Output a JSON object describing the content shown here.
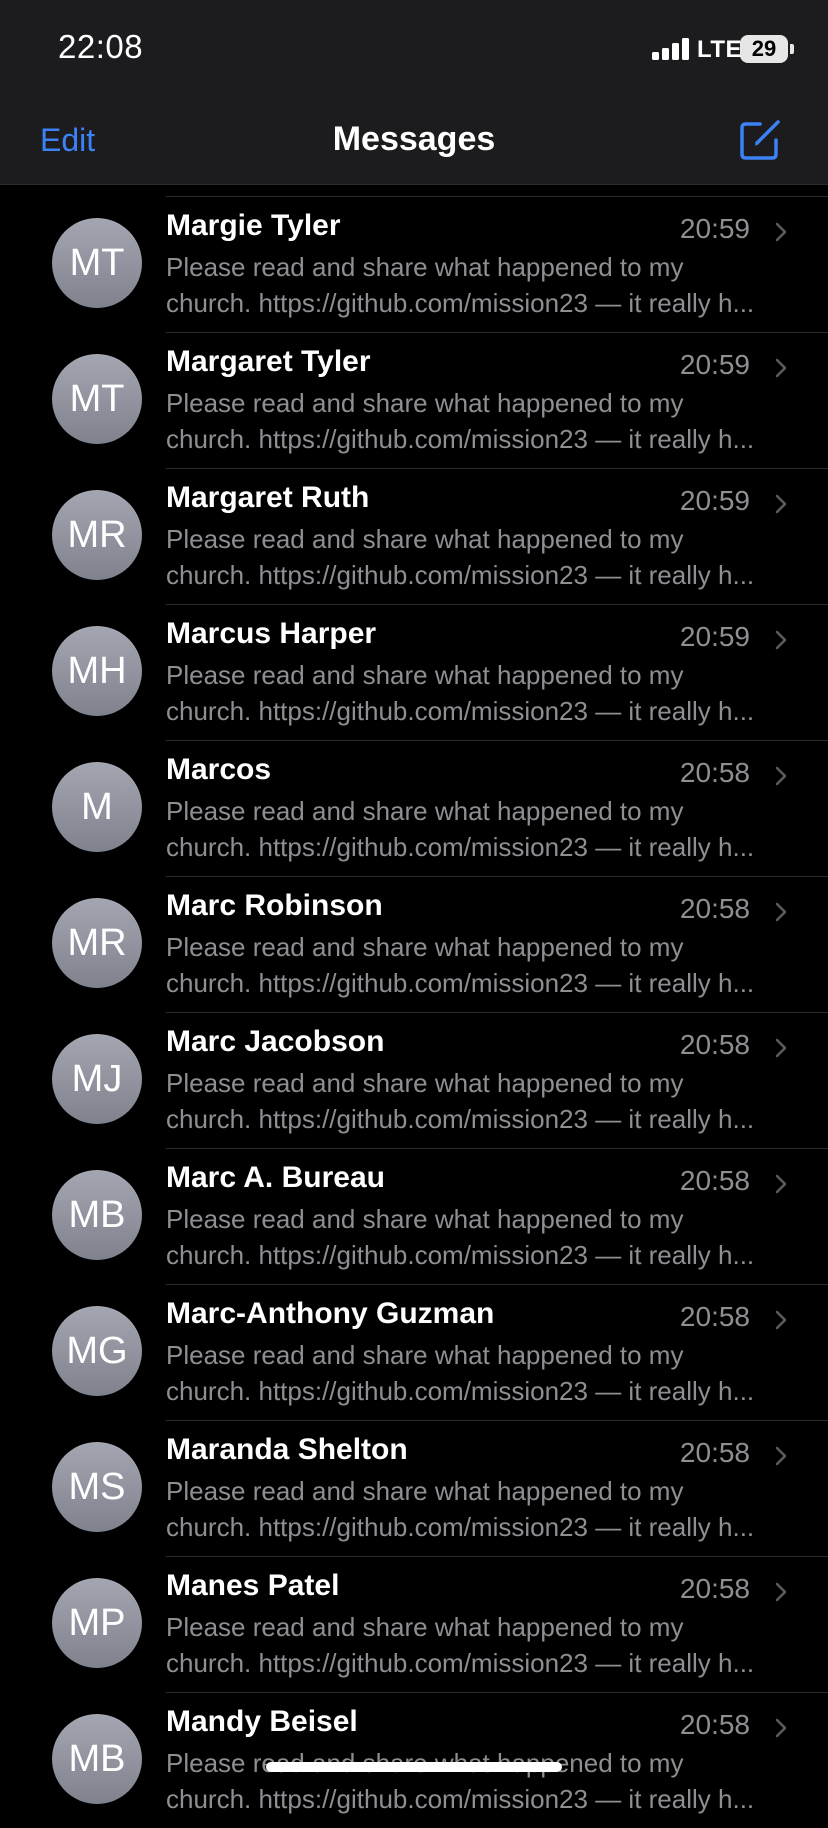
{
  "status": {
    "time": "22:08",
    "network": "LTE",
    "battery": "29"
  },
  "nav": {
    "edit_label": "Edit",
    "title": "Messages",
    "compose_icon": "compose-icon"
  },
  "colors": {
    "accent": "#3b82f6",
    "background": "#000000",
    "secondary_text": "#8e8e93",
    "avatar": "#9a9ca8"
  },
  "conversations": [
    {
      "initials": "MT",
      "name": "Margie Tyler",
      "time": "20:59",
      "preview_line1": "Please read and share what happened to my",
      "preview_line2": "church. https://github.com/mission23 — it really h..."
    },
    {
      "initials": "MT",
      "name": "Margaret Tyler",
      "time": "20:59",
      "preview_line1": "Please read and share what happened to my",
      "preview_line2": "church. https://github.com/mission23 — it really h..."
    },
    {
      "initials": "MR",
      "name": "Margaret Ruth",
      "time": "20:59",
      "preview_line1": "Please read and share what happened to my",
      "preview_line2": "church. https://github.com/mission23 — it really h..."
    },
    {
      "initials": "MH",
      "name": "Marcus Harper",
      "time": "20:59",
      "preview_line1": "Please read and share what happened to my",
      "preview_line2": "church. https://github.com/mission23 — it really h..."
    },
    {
      "initials": "M",
      "name": "Marcos",
      "time": "20:58",
      "preview_line1": "Please read and share what happened to my",
      "preview_line2": "church. https://github.com/mission23 — it really h..."
    },
    {
      "initials": "MR",
      "name": "Marc Robinson",
      "time": "20:58",
      "preview_line1": "Please read and share what happened to my",
      "preview_line2": "church. https://github.com/mission23 — it really h..."
    },
    {
      "initials": "MJ",
      "name": "Marc Jacobson",
      "time": "20:58",
      "preview_line1": "Please read and share what happened to my",
      "preview_line2": "church. https://github.com/mission23 — it really h..."
    },
    {
      "initials": "MB",
      "name": "Marc A. Bureau",
      "time": "20:58",
      "preview_line1": "Please read and share what happened to my",
      "preview_line2": "church. https://github.com/mission23 — it really h..."
    },
    {
      "initials": "MG",
      "name": "Marc-Anthony Guzman",
      "time": "20:58",
      "preview_line1": "Please read and share what happened to my",
      "preview_line2": "church. https://github.com/mission23 — it really h..."
    },
    {
      "initials": "MS",
      "name": "Maranda Shelton",
      "time": "20:58",
      "preview_line1": "Please read and share what happened to my",
      "preview_line2": "church. https://github.com/mission23 — it really h..."
    },
    {
      "initials": "MP",
      "name": "Manes Patel",
      "time": "20:58",
      "preview_line1": "Please read and share what happened to my",
      "preview_line2": "church. https://github.com/mission23 — it really h..."
    },
    {
      "initials": "MB",
      "name": "Mandy Beisel",
      "time": "20:58",
      "preview_line1": "Please read and share what happened to my",
      "preview_line2": "church. https://github.com/mission23 — it really h..."
    }
  ]
}
